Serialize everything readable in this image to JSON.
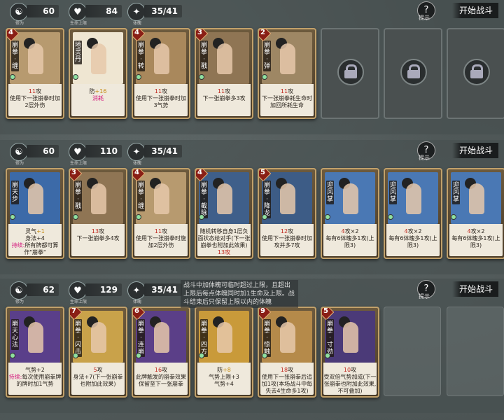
{
  "stat_labels": {
    "cultivation": "修为",
    "hp": "生命上限",
    "body": "体魄"
  },
  "hint_label": "提示",
  "start_label": "开始战斗",
  "rows": [
    {
      "cultivation": "60",
      "hp": "84",
      "body": "35/41",
      "cards": [
        {
          "cost": "4",
          "name": "崩拳·缠",
          "art": "#b79a6f",
          "lines": [
            {
              "t": "11",
              "c": "red"
            },
            {
              "t": "攻"
            },
            {
              "t": "使用下一张崩拳时加2层外伤",
              "br": true
            }
          ]
        },
        {
          "cost": "",
          "name": "地灵丹",
          "art": "#efe6d2",
          "lines": [
            {
              "t": "防"
            },
            {
              "t": "+16",
              "c": "gold"
            },
            {
              "t": "消耗",
              "c": "pink",
              "br": true
            }
          ]
        },
        {
          "cost": "4",
          "name": "崩拳·转",
          "art": "#a9885c",
          "lines": [
            {
              "t": "11",
              "c": "red"
            },
            {
              "t": "攻"
            },
            {
              "t": "使用下一张崩拳时加3气势",
              "br": true
            }
          ]
        },
        {
          "cost": "3",
          "name": "崩拳·戳",
          "art": "#8f7554",
          "lines": [
            {
              "t": "11",
              "c": "red"
            },
            {
              "t": "攻"
            },
            {
              "t": "下一张崩拳多3攻",
              "br": true
            }
          ]
        },
        {
          "cost": "2",
          "name": "崩拳·弹",
          "art": "#9e8764",
          "lines": [
            {
              "t": "11",
              "c": "red"
            },
            {
              "t": "攻"
            },
            {
              "t": "下一张崩拳耗生命时加回所耗生命",
              "br": true
            }
          ]
        }
      ],
      "locked": 3,
      "empty": 0
    },
    {
      "cultivation": "60",
      "hp": "110",
      "body": "35/41",
      "cards": [
        {
          "cost": "",
          "name": "崩天步",
          "art": "#3c6aa8",
          "lines": [
            {
              "t": "灵气"
            },
            {
              "t": "+1",
              "c": "gold"
            },
            {
              "t": "身法+4",
              "br": true
            },
            {
              "t": "持续:",
              "c": "pink",
              "br": true
            },
            {
              "t": "所有牌都可算作\"崩拳\""
            }
          ]
        },
        {
          "cost": "3",
          "name": "崩拳·戳",
          "art": "#8f7554",
          "lines": [
            {
              "t": "13",
              "c": "red"
            },
            {
              "t": "攻"
            },
            {
              "t": "下一张崩拳多4攻",
              "br": true
            }
          ]
        },
        {
          "cost": "4",
          "name": "崩拳·缠",
          "art": "#b79a6f",
          "lines": [
            {
              "t": "11",
              "c": "red"
            },
            {
              "t": "攻"
            },
            {
              "t": "使用下一张崩拳时施加2层外伤",
              "br": true
            }
          ]
        },
        {
          "cost": "4",
          "name": "崩拳·截脉",
          "art": "#3f5f8a",
          "lines": [
            {
              "t": "随机转移自身1层负面状态给对手(下一张崩拳也附加此效果)",
              "br": false
            },
            {
              "t": "13攻",
              "c": "red",
              "br": true
            }
          ]
        },
        {
          "cost": "5",
          "name": "崩拳·降龙",
          "art": "#3d5c86",
          "lines": [
            {
              "t": "12",
              "c": "red"
            },
            {
              "t": "攻"
            },
            {
              "t": "使用下一张崩拳时加攻并多7攻",
              "br": true
            }
          ]
        },
        {
          "cost": "",
          "name": "迎风掌",
          "art": "#4a78b4",
          "lines": [
            {
              "t": "4",
              "c": "red"
            },
            {
              "t": "攻×2"
            },
            {
              "t": "每有6体魄多1攻(上限3)",
              "br": true
            }
          ]
        },
        {
          "cost": "",
          "name": "迎风掌",
          "art": "#4a78b4",
          "lines": [
            {
              "t": "4",
              "c": "red"
            },
            {
              "t": "攻×2"
            },
            {
              "t": "每有6体魄多1攻(上限3)",
              "br": true
            }
          ]
        },
        {
          "cost": "",
          "name": "迎风掌",
          "art": "#4a78b4",
          "lines": [
            {
              "t": "4",
              "c": "red"
            },
            {
              "t": "攻×2"
            },
            {
              "t": "每有6体魄多1攻(上限3)",
              "br": true
            }
          ]
        }
      ],
      "locked": 0,
      "empty": 0
    },
    {
      "cultivation": "62",
      "hp": "129",
      "body": "35/41",
      "cards": [
        {
          "cost": "",
          "name": "崩天心法",
          "art": "#5a3f8a",
          "lines": [
            {
              "t": "气势+2"
            },
            {
              "t": "持续:",
              "c": "pink",
              "br": true
            },
            {
              "t": "每次使用崩拳牌的牌时加1气势"
            }
          ]
        },
        {
          "cost": "7",
          "name": "崩拳·闪击",
          "art": "#c9a24a",
          "lines": [
            {
              "t": "5",
              "c": "red"
            },
            {
              "t": "攻"
            },
            {
              "t": "身法+7(下一张崩拳也附加此效果)",
              "br": true
            }
          ]
        },
        {
          "cost": "6",
          "name": "崩拳·连崩",
          "art": "#5b3f88",
          "lines": [
            {
              "t": "16",
              "c": "red"
            },
            {
              "t": "攻"
            },
            {
              "t": "此牌触发的崩拳效果保留至下一张崩拳",
              "br": true
            }
          ]
        },
        {
          "cost": "",
          "name": "崩拳·四方",
          "art": "#c99a3a",
          "lines": [
            {
              "t": "防"
            },
            {
              "t": "+8",
              "c": "gold"
            },
            {
              "t": "气势上限+3",
              "br": true
            },
            {
              "t": "气势+4",
              "br": true
            }
          ]
        },
        {
          "cost": "9",
          "name": "崩拳·惊触",
          "art": "#b58a4a",
          "lines": [
            {
              "t": "18",
              "c": "red"
            },
            {
              "t": "攻"
            },
            {
              "t": "使用下一张崩拳后追加1攻(本场战斗中每失去4生命多1攻)",
              "br": true
            }
          ]
        },
        {
          "cost": "5",
          "name": "崩拳·寸劲",
          "art": "#4b3a78",
          "lines": [
            {
              "t": "10",
              "c": "red"
            },
            {
              "t": "攻"
            },
            {
              "t": "受双倍气势加成(下一张崩拳也附加此效果,不可叠加)",
              "br": true
            }
          ]
        }
      ],
      "locked": 0,
      "empty": 2
    }
  ],
  "tooltip": "战斗中加体魄可临时超过上限，且超出上限后每点体魄同时加1生命及上限。战斗结束后只保留上限以内的体魄"
}
